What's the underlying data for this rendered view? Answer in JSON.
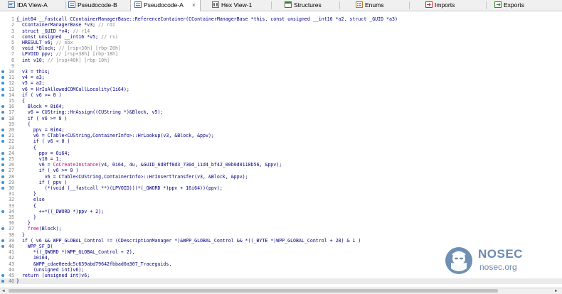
{
  "tabs": [
    {
      "label": "IDA View-A",
      "icon": "ida-view-icon"
    },
    {
      "label": "Pseudocode-B",
      "icon": "pseudocode-icon"
    },
    {
      "label": "Pseudocode-A",
      "icon": "pseudocode-icon",
      "active": true,
      "close": "×"
    },
    {
      "label": "Hex View-1",
      "icon": "hex-view-icon"
    },
    {
      "label": "Structures",
      "icon": "structures-icon"
    },
    {
      "label": "Enums",
      "icon": "enums-icon"
    },
    {
      "label": "Imports",
      "icon": "imports-icon"
    },
    {
      "label": "Exports",
      "icon": "exports-icon"
    }
  ],
  "colors": {
    "keyword": "#000080",
    "comment": "#888888",
    "macro": "#c0007a",
    "dot": "#3a8fd0",
    "highlight": "#ebebeb"
  },
  "code": {
    "signature": "__int64 __fastcall CContainerManagerBase::ReferenceContainer(CContainerManagerBase *this, const unsigned __int16 *a2, struct _GUID *a3)",
    "lines": [
      {
        "n": "1",
        "dot": false,
        "hl": false,
        "p": [
          [
            "{",
            ""
          ]
        ]
      },
      {
        "n": "2",
        "dot": false,
        "hl": false,
        "p": [
          [
            "  CContainerManagerBase *v3; ",
            "kw"
          ],
          [
            "// rdi",
            "cm"
          ]
        ]
      },
      {
        "n": "3",
        "dot": false,
        "hl": false,
        "p": [
          [
            "  struct _GUID *v4; ",
            "kw"
          ],
          [
            "// r14",
            "cm"
          ]
        ]
      },
      {
        "n": "4",
        "dot": false,
        "hl": false,
        "p": [
          [
            "  const unsigned __int16 *v5; ",
            "kw"
          ],
          [
            "// rsi",
            "cm"
          ]
        ]
      },
      {
        "n": "5",
        "dot": false,
        "hl": false,
        "p": [
          [
            "  HRESULT v6; ",
            "kw"
          ],
          [
            "// ebx",
            "cm"
          ]
        ]
      },
      {
        "n": "6",
        "dot": false,
        "hl": false,
        "p": [
          [
            "  void *Block; ",
            "kw"
          ],
          [
            "// [rsp+30h] [rbp-20h]",
            "cm"
          ]
        ]
      },
      {
        "n": "7",
        "dot": false,
        "hl": false,
        "p": [
          [
            "  LPVOID ppv; ",
            "kw"
          ],
          [
            "// [rsp+38h] [rbp-18h]",
            "cm"
          ]
        ]
      },
      {
        "n": "8",
        "dot": false,
        "hl": false,
        "p": [
          [
            "  int v10; ",
            "kw"
          ],
          [
            "// [rsp+40h] [rbp-10h]",
            "cm"
          ]
        ]
      },
      {
        "n": "9",
        "dot": false,
        "hl": false,
        "p": [
          [
            "",
            ""
          ]
        ]
      },
      {
        "n": "10",
        "dot": true,
        "hl": false,
        "p": [
          [
            "  v3 = this;",
            "kw"
          ]
        ]
      },
      {
        "n": "11",
        "dot": true,
        "hl": false,
        "p": [
          [
            "  v4 = a3;",
            "kw"
          ]
        ]
      },
      {
        "n": "12",
        "dot": true,
        "hl": false,
        "p": [
          [
            "  v5 = a2;",
            "kw"
          ]
        ]
      },
      {
        "n": "13",
        "dot": true,
        "hl": false,
        "p": [
          [
            "  v6 = HrIsAllowedCOMCallLocality(1i64);",
            "kw"
          ]
        ]
      },
      {
        "n": "14",
        "dot": true,
        "hl": false,
        "p": [
          [
            "  if ( v6 >= 0 )",
            "kw"
          ]
        ]
      },
      {
        "n": "15",
        "dot": false,
        "hl": false,
        "p": [
          [
            "  {",
            "kw"
          ]
        ]
      },
      {
        "n": "16",
        "dot": true,
        "hl": false,
        "p": [
          [
            "    Block = 0i64;",
            "kw"
          ]
        ]
      },
      {
        "n": "17",
        "dot": true,
        "hl": false,
        "p": [
          [
            "    v6 = CUString::HrAssign((CUString *)&Block, v5);",
            "kw"
          ]
        ]
      },
      {
        "n": "18",
        "dot": true,
        "hl": false,
        "p": [
          [
            "    if ( v6 >= 0 )",
            "kw"
          ]
        ]
      },
      {
        "n": "19",
        "dot": false,
        "hl": false,
        "p": [
          [
            "    {",
            "kw"
          ]
        ]
      },
      {
        "n": "20",
        "dot": true,
        "hl": false,
        "p": [
          [
            "      ppv = 0i64;",
            "kw"
          ]
        ]
      },
      {
        "n": "21",
        "dot": true,
        "hl": false,
        "p": [
          [
            "      v6 = CTable<CUString,ContainerInfo>::HrLookup(v3, &Block, &ppv);",
            "kw"
          ]
        ]
      },
      {
        "n": "22",
        "dot": true,
        "hl": false,
        "p": [
          [
            "      if ( v6 < 0 )",
            "kw"
          ]
        ]
      },
      {
        "n": "23",
        "dot": false,
        "hl": false,
        "p": [
          [
            "      {",
            "kw"
          ]
        ]
      },
      {
        "n": "24",
        "dot": true,
        "hl": false,
        "p": [
          [
            "        ppv = 0i64;",
            "kw"
          ]
        ]
      },
      {
        "n": "25",
        "dot": true,
        "hl": false,
        "p": [
          [
            "        v10 = 1;",
            "kw"
          ]
        ]
      },
      {
        "n": "26",
        "dot": true,
        "hl": false,
        "p": [
          [
            "        v6 = ",
            "kw"
          ],
          [
            "CoCreateInstance",
            "mc"
          ],
          [
            "(v4, 0i64, 4u, &GUID_6d8ff8d3_730d_11d4_bf42_00b0d0118b56, &ppv);",
            "kw"
          ]
        ]
      },
      {
        "n": "27",
        "dot": true,
        "hl": false,
        "p": [
          [
            "        if ( v6 >= 0 )",
            "kw"
          ]
        ]
      },
      {
        "n": "28",
        "dot": true,
        "hl": false,
        "p": [
          [
            "          v6 = CTable<CUString,ContainerInfo>::HrInsertTransfer(v3, &Block, &ppv);",
            "kw"
          ]
        ]
      },
      {
        "n": "29",
        "dot": true,
        "hl": false,
        "p": [
          [
            "        if ( ppv )",
            "kw"
          ]
        ]
      },
      {
        "n": "30",
        "dot": true,
        "hl": false,
        "p": [
          [
            "          (*(void (__fastcall **)(LPVOID))(*(_QWORD *)ppv + 16i64))(ppv);",
            "kw"
          ]
        ]
      },
      {
        "n": "31",
        "dot": false,
        "hl": false,
        "p": [
          [
            "      }",
            "kw"
          ]
        ]
      },
      {
        "n": "32",
        "dot": false,
        "hl": false,
        "p": [
          [
            "      else",
            "kw"
          ]
        ]
      },
      {
        "n": "33",
        "dot": false,
        "hl": false,
        "p": [
          [
            "      {",
            "kw"
          ]
        ]
      },
      {
        "n": "34",
        "dot": true,
        "hl": false,
        "p": [
          [
            "        ++*((_DWORD *)ppv + 2);",
            "kw"
          ]
        ]
      },
      {
        "n": "35",
        "dot": false,
        "hl": false,
        "p": [
          [
            "      }",
            "kw"
          ]
        ]
      },
      {
        "n": "36",
        "dot": false,
        "hl": false,
        "p": [
          [
            "    }",
            "kw"
          ]
        ]
      },
      {
        "n": "37",
        "dot": true,
        "hl": false,
        "p": [
          [
            "    ",
            "kw"
          ],
          [
            "free",
            "mc"
          ],
          [
            "(Block);",
            "kw"
          ]
        ]
      },
      {
        "n": "38",
        "dot": false,
        "hl": false,
        "p": [
          [
            "  }",
            "kw"
          ]
        ]
      },
      {
        "n": "39",
        "dot": true,
        "hl": false,
        "p": [
          [
            "  if ( v6 && WPP_GLOBAL_Control != (CDescriptionManager *)&WPP_GLOBAL_Control && *((_BYTE *)WPP_GLOBAL_Control + 28) & 1 )",
            "kw"
          ]
        ]
      },
      {
        "n": "40",
        "dot": true,
        "hl": false,
        "p": [
          [
            "    WPP_SF_D(",
            "kw"
          ]
        ]
      },
      {
        "n": "41",
        "dot": false,
        "hl": false,
        "p": [
          [
            "      *((_QWORD *)WPP_GLOBAL_Control + 2),",
            "kw"
          ]
        ]
      },
      {
        "n": "42",
        "dot": false,
        "hl": false,
        "p": [
          [
            "      10i64,",
            "kw"
          ]
        ]
      },
      {
        "n": "43",
        "dot": false,
        "hl": false,
        "p": [
          [
            "      &WPP_cdae0eedc5c639abd79642fbbad0a307_Traceguids,",
            "kw"
          ]
        ]
      },
      {
        "n": "44",
        "dot": false,
        "hl": false,
        "p": [
          [
            "      (unsigned int)v6);",
            "kw"
          ]
        ]
      },
      {
        "n": "45",
        "dot": true,
        "hl": false,
        "p": [
          [
            "  return (unsigned int)v6;",
            "kw"
          ]
        ]
      },
      {
        "n": "46",
        "dot": true,
        "hl": true,
        "p": [
          [
            "}",
            "kw"
          ]
        ]
      }
    ]
  },
  "watermark": {
    "title": "NOSEC",
    "url": "nosec.org"
  }
}
